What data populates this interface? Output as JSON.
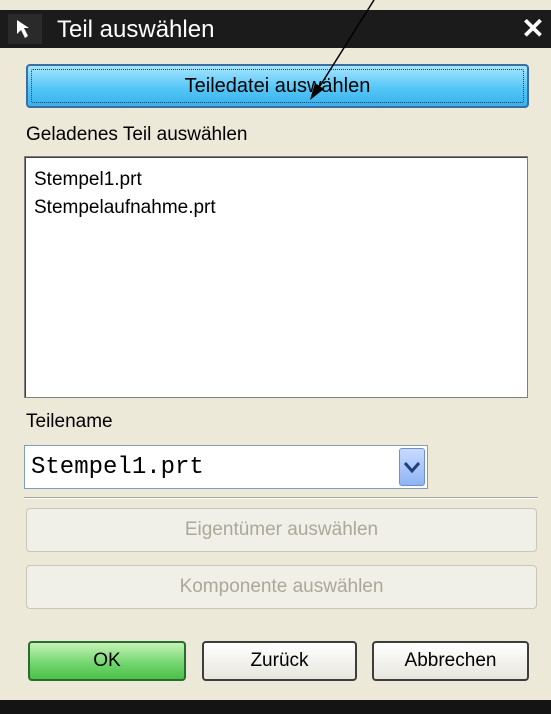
{
  "window": {
    "title": "Teil auswählen",
    "close_symbol": "✕"
  },
  "buttons": {
    "select_file": "Teiledatei auswählen",
    "select_owner": "Eigentümer auswählen",
    "select_component": "Komponente auswählen",
    "ok": "OK",
    "back": "Zurück",
    "cancel": "Abbrechen"
  },
  "loaded_parts": {
    "label": "Geladenes Teil auswählen",
    "items": [
      "Stempel1.prt",
      "Stempelaufnahme.prt"
    ]
  },
  "part_name": {
    "label": "Teilename",
    "value": "Stempel1.prt"
  },
  "icons": {
    "title_icon": "select-arrow-icon",
    "combo_arrow": "chevron-down-icon",
    "annotation": "pointer-arrow-annotation"
  },
  "colors": {
    "titlebar": "#1b1b1b",
    "primary_button": "#56c6f6",
    "ok_button": "#6fd46b",
    "dialog_bg": "#ece9d8"
  }
}
